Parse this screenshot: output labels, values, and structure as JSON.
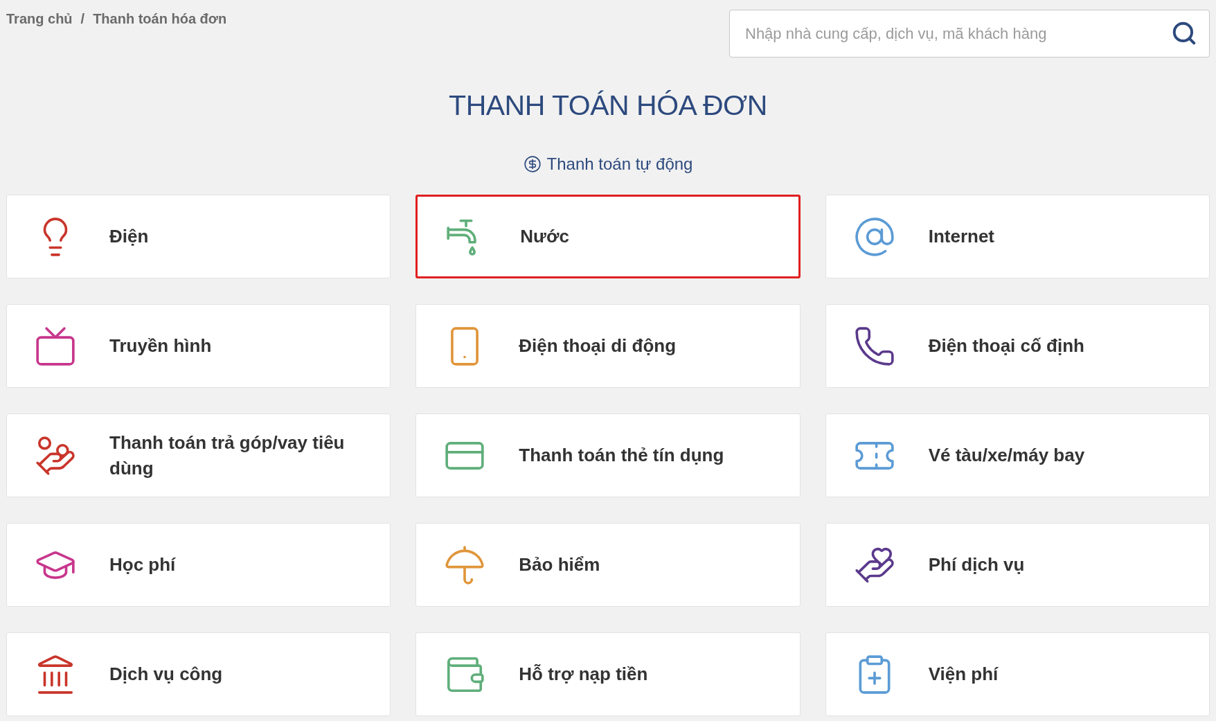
{
  "breadcrumb": [
    {
      "label": "Trang chủ"
    },
    {
      "label": "Thanh toán hóa đơn"
    }
  ],
  "breadcrumb_separator": "/",
  "search": {
    "placeholder": "Nhập nhà cung cấp, dịch vụ, mã khách hàng"
  },
  "title": "THANH TOÁN HÓA ĐƠN",
  "auto_pay_link": "Thanh toán tự động",
  "services": [
    {
      "label": "Điện",
      "kind": "bulb",
      "color": "#c9352b",
      "selected": false
    },
    {
      "label": "Nước",
      "kind": "faucet",
      "color": "#5fae7a",
      "selected": true
    },
    {
      "label": "Internet",
      "kind": "at",
      "color": "#5b9bd5",
      "selected": false
    },
    {
      "label": "Truyền hình",
      "kind": "tv",
      "color": "#c8368c",
      "selected": false
    },
    {
      "label": "Điện thoại di động",
      "kind": "mobile",
      "color": "#e0953a",
      "selected": false
    },
    {
      "label": "Điện thoại cố định",
      "kind": "phone",
      "color": "#5b3a8c",
      "selected": false
    },
    {
      "label": "Thanh toán trả góp/vay tiêu dùng",
      "kind": "coins",
      "color": "#c9352b",
      "selected": false
    },
    {
      "label": "Thanh toán thẻ tín dụng",
      "kind": "card",
      "color": "#5fae7a",
      "selected": false
    },
    {
      "label": "Vé tàu/xe/máy bay",
      "kind": "ticket",
      "color": "#5b9bd5",
      "selected": false
    },
    {
      "label": "Học phí",
      "kind": "cap",
      "color": "#c8368c",
      "selected": false
    },
    {
      "label": "Bảo hiểm",
      "kind": "umbrella",
      "color": "#e0953a",
      "selected": false
    },
    {
      "label": "Phí dịch vụ",
      "kind": "moneybag",
      "color": "#5b3a8c",
      "selected": false
    },
    {
      "label": "Dịch vụ công",
      "kind": "emblem",
      "color": "#c9352b",
      "selected": false
    },
    {
      "label": "Hỗ trợ nạp tiền",
      "kind": "wallet",
      "color": "#5fae7a",
      "selected": false
    },
    {
      "label": "Viện phí",
      "kind": "hospital",
      "color": "#5b9bd5",
      "selected": false
    }
  ]
}
